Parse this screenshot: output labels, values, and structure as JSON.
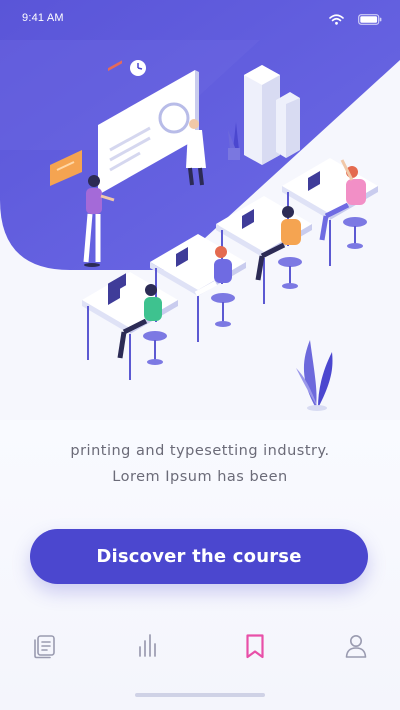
{
  "status_bar": {
    "time": "9:41 AM",
    "icons": [
      "wifi-icon",
      "battery-icon"
    ]
  },
  "hero": {
    "illustration": "office-team-illustration"
  },
  "description": {
    "lines": [
      "printing and typesetting industry.",
      "Lorem Ipsum has been"
    ]
  },
  "cta": {
    "label": "Discover the course"
  },
  "bottom_nav": {
    "items": [
      {
        "icon": "courses-icon",
        "active": false
      },
      {
        "icon": "stats-icon",
        "active": false
      },
      {
        "icon": "bookmark-icon",
        "active": true
      },
      {
        "icon": "profile-icon",
        "active": false
      }
    ]
  },
  "colors": {
    "primary": "#4b47cf",
    "active_nav": "#e84fa8",
    "inactive_nav": "#9a9bb0",
    "text": "#6b6b78"
  }
}
